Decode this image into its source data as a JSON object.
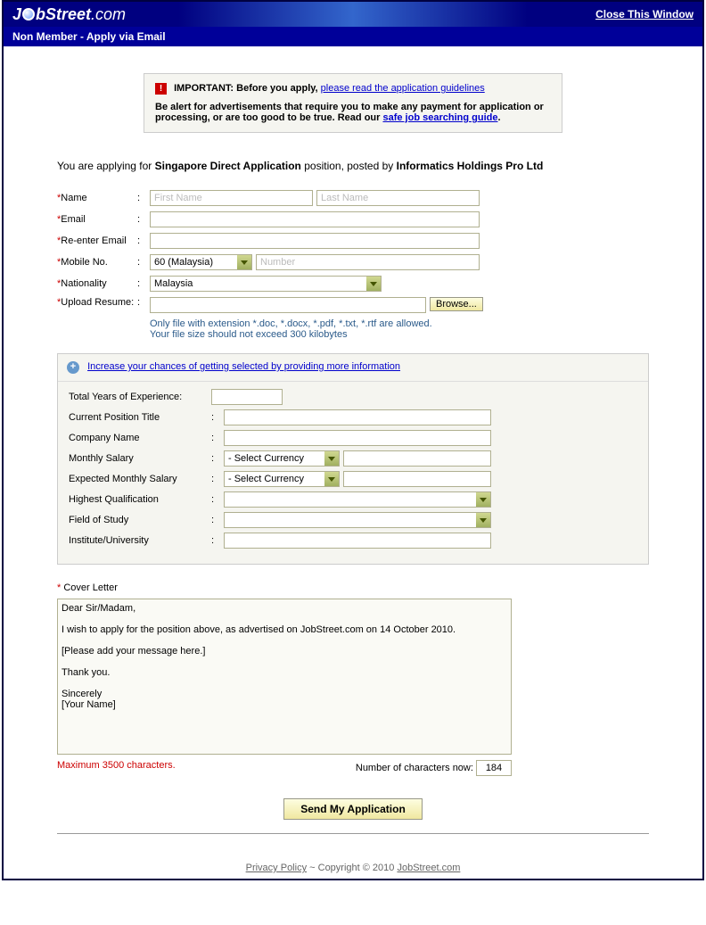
{
  "header": {
    "logo_pre": "J",
    "logo_mid": "bStreet",
    "logo_suf": ".com",
    "close": "Close This Window"
  },
  "subheader": "Non Member - Apply via Email",
  "notice": {
    "important_label": "IMPORTANT: Before you apply,",
    "guidelines_link": "please read the application guidelines",
    "alert_text": "Be alert for advertisements that require you to make any payment for application or processing, or are too good to be true. Read our ",
    "safe_link": "safe job searching guide",
    "period": "."
  },
  "applying": {
    "prefix": "You are applying for ",
    "position": "Singapore Direct Application",
    "middle": " position, posted by ",
    "company": "Informatics Holdings Pro Ltd"
  },
  "form": {
    "name_label": "Name",
    "first_placeholder": "First Name",
    "last_placeholder": "Last Name",
    "email_label": "Email",
    "reemail_label": "Re-enter Email",
    "mobile_label": "Mobile No.",
    "country_code": "60 (Malaysia)",
    "mobile_placeholder": "Number",
    "nationality_label": "Nationality",
    "nationality_value": "Malaysia",
    "resume_label": "Upload Resume:",
    "browse": "Browse...",
    "file_note1": "Only file with extension *.doc, *.docx, *.pdf, *.txt, *.rtf are allowed.",
    "file_note2": "Your file size should not exceed 300 kilobytes"
  },
  "expand": {
    "link": "Increase your chances of getting selected by providing more information",
    "exp_label": "Total Years of Experience:",
    "position_label": "Current Position Title",
    "company_label": "Company Name",
    "salary_label": "Monthly Salary",
    "exp_salary_label": "Expected Monthly Salary",
    "currency_placeholder": "- Select Currency",
    "qual_label": "Highest Qualification",
    "field_label": "Field of Study",
    "institute_label": "Institute/University"
  },
  "cover": {
    "label": "Cover Letter",
    "text": "Dear Sir/Madam,\n\nI wish to apply for the position above, as advertised on JobStreet.com on 14 October 2010.\n\n[Please add your message here.]\n\nThank you.\n\nSincerely\n[Your Name]",
    "max": "Maximum 3500 characters.",
    "count_label": "Number of characters now:",
    "count": "184"
  },
  "submit": "Send My Application",
  "footer": {
    "privacy": "Privacy Policy",
    "sep": " ~ ",
    "copyright": "Copyright © 2010 ",
    "jobstreet": "JobStreet.com"
  }
}
